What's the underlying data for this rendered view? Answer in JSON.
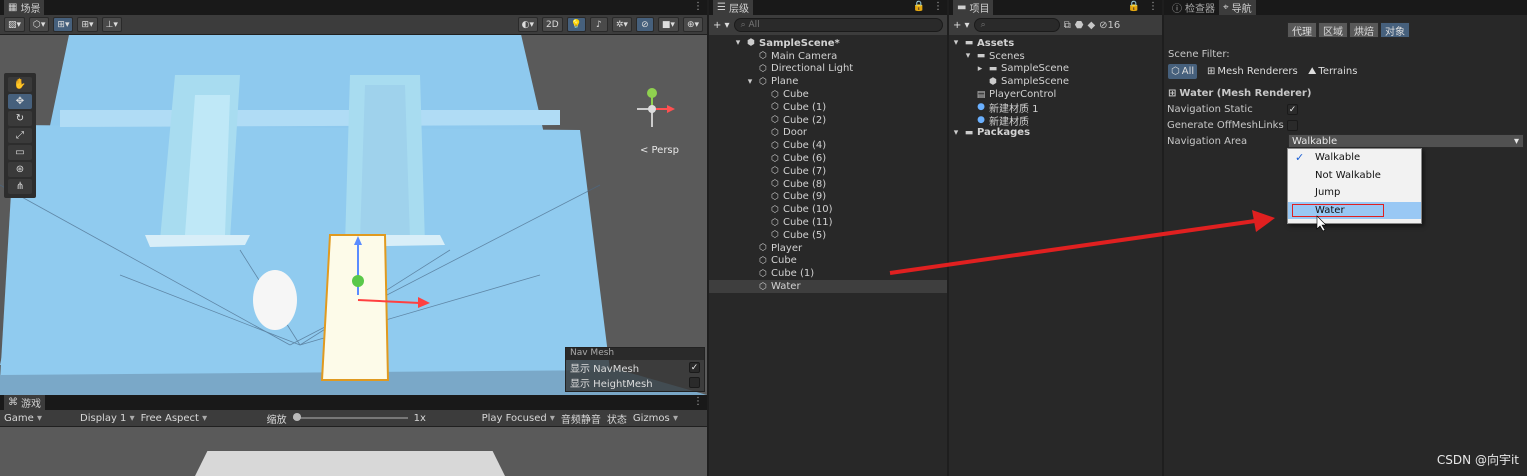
{
  "scene_panel": {
    "tab": "场景",
    "toolbar": {
      "btn_2d": "2D"
    },
    "persp_label": "< Persp",
    "navmesh_overlay": {
      "title": "Nav Mesh",
      "rows": [
        {
          "label": "显示 NavMesh",
          "checked": true
        },
        {
          "label": "显示 HeightMesh",
          "checked": false
        }
      ]
    }
  },
  "game_panel": {
    "tab": "游戏",
    "mode": "Game",
    "display": "Display 1",
    "aspect": "Free Aspect",
    "scale_label": "缩放",
    "scale_value": "1x",
    "play_focused": "Play Focused",
    "mute": "音频静音",
    "stats": "状态",
    "gizmos": "Gizmos"
  },
  "hierarchy": {
    "tab": "层级",
    "search_placeholder": "All",
    "items": [
      {
        "label": "SampleScene*",
        "depth": 0,
        "kind": "scene",
        "expanded": true
      },
      {
        "label": "Main Camera",
        "depth": 1,
        "kind": "go"
      },
      {
        "label": "Directional Light",
        "depth": 1,
        "kind": "go"
      },
      {
        "label": "Plane",
        "depth": 1,
        "kind": "go",
        "expanded": true
      },
      {
        "label": "Cube",
        "depth": 2,
        "kind": "go"
      },
      {
        "label": "Cube (1)",
        "depth": 2,
        "kind": "go"
      },
      {
        "label": "Cube (2)",
        "depth": 2,
        "kind": "go"
      },
      {
        "label": "Door",
        "depth": 2,
        "kind": "go"
      },
      {
        "label": "Cube (4)",
        "depth": 2,
        "kind": "go"
      },
      {
        "label": "Cube (6)",
        "depth": 2,
        "kind": "go"
      },
      {
        "label": "Cube (7)",
        "depth": 2,
        "kind": "go"
      },
      {
        "label": "Cube (8)",
        "depth": 2,
        "kind": "go"
      },
      {
        "label": "Cube (9)",
        "depth": 2,
        "kind": "go"
      },
      {
        "label": "Cube (10)",
        "depth": 2,
        "kind": "go"
      },
      {
        "label": "Cube (11)",
        "depth": 2,
        "kind": "go"
      },
      {
        "label": "Cube (5)",
        "depth": 2,
        "kind": "go"
      },
      {
        "label": "Player",
        "depth": 1,
        "kind": "go"
      },
      {
        "label": "Cube",
        "depth": 1,
        "kind": "go"
      },
      {
        "label": "Cube (1)",
        "depth": 1,
        "kind": "go"
      },
      {
        "label": "Water",
        "depth": 1,
        "kind": "go",
        "selected": true
      }
    ]
  },
  "project": {
    "tab": "项目",
    "hidden_count": "16",
    "items": [
      {
        "label": "Assets",
        "depth": 0,
        "kind": "folder",
        "bold": true
      },
      {
        "label": "Scenes",
        "depth": 1,
        "kind": "folder"
      },
      {
        "label": "SampleScene",
        "depth": 2,
        "kind": "folder"
      },
      {
        "label": "SampleScene",
        "depth": 2,
        "kind": "scene"
      },
      {
        "label": "PlayerControl",
        "depth": 1,
        "kind": "script"
      },
      {
        "label": "新建材质 1",
        "depth": 1,
        "kind": "material"
      },
      {
        "label": "新建材质",
        "depth": 1,
        "kind": "material"
      },
      {
        "label": "Packages",
        "depth": 0,
        "kind": "folder",
        "bold": true
      }
    ]
  },
  "inspector": {
    "tab_inspector": "检查器",
    "tab_navigation": "导航",
    "nav_tabs": [
      "代理",
      "区域",
      "烘焙",
      "对象"
    ],
    "active_nav_tab": 3,
    "scene_filter_label": "Scene Filter:",
    "filters": [
      "All",
      "Mesh Renderers",
      "Terrains"
    ],
    "object_title": "Water (Mesh Renderer)",
    "navigation_static_label": "Navigation Static",
    "navigation_static_checked": true,
    "generate_offmesh_label": "Generate OffMeshLinks",
    "generate_offmesh_checked": false,
    "navigation_area_label": "Navigation Area",
    "navigation_area_value": "Walkable",
    "area_options": [
      "Walkable",
      "Not Walkable",
      "Jump",
      "Water"
    ],
    "checked_option": "Walkable",
    "highlighted_option": "Water"
  },
  "watermark": "CSDN @向宇it",
  "colors": {
    "arrow": "#e02020",
    "selection": "#46607c",
    "navmesh": "#8ec9ee"
  }
}
